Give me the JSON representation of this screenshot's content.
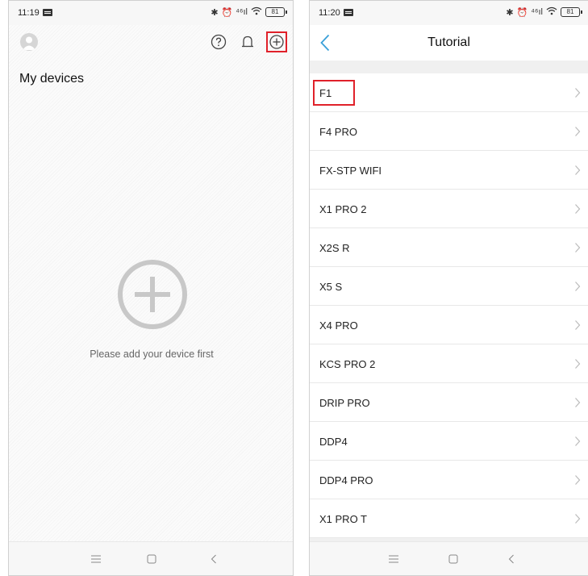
{
  "left_screen": {
    "statusbar": {
      "time": "11:19",
      "signal_text": "⁴⁶ıl",
      "battery": "81"
    },
    "topbar": {
      "avatar_icon": "user-avatar-icon",
      "help_icon": "help-circle-icon",
      "bell_icon": "bell-icon",
      "add_icon": "add-circle-icon"
    },
    "section_title": "My devices",
    "empty_state": {
      "icon": "add-circle-large-icon",
      "message": "Please add your device first"
    },
    "highlight_color": "#e0212a"
  },
  "right_screen": {
    "statusbar": {
      "time": "11:20",
      "signal_text": "⁴⁶ıl",
      "battery": "81"
    },
    "header": {
      "back_icon": "chevron-left-icon",
      "title": "Tutorial"
    },
    "devices": [
      {
        "label": "F1"
      },
      {
        "label": "F4 PRO"
      },
      {
        "label": "FX-STP WIFI"
      },
      {
        "label": "X1 PRO 2"
      },
      {
        "label": "X2S R"
      },
      {
        "label": "X5 S"
      },
      {
        "label": "X4 PRO"
      },
      {
        "label": "KCS PRO 2"
      },
      {
        "label": "DRIP PRO"
      },
      {
        "label": "DDP4"
      },
      {
        "label": "DDP4 PRO"
      },
      {
        "label": "X1 PRO T"
      }
    ],
    "accent_color": "#3aa0d8"
  },
  "navbar": {
    "menu_icon": "menu-lines-icon",
    "home_icon": "square-home-icon",
    "back_icon": "chevron-left-icon"
  }
}
